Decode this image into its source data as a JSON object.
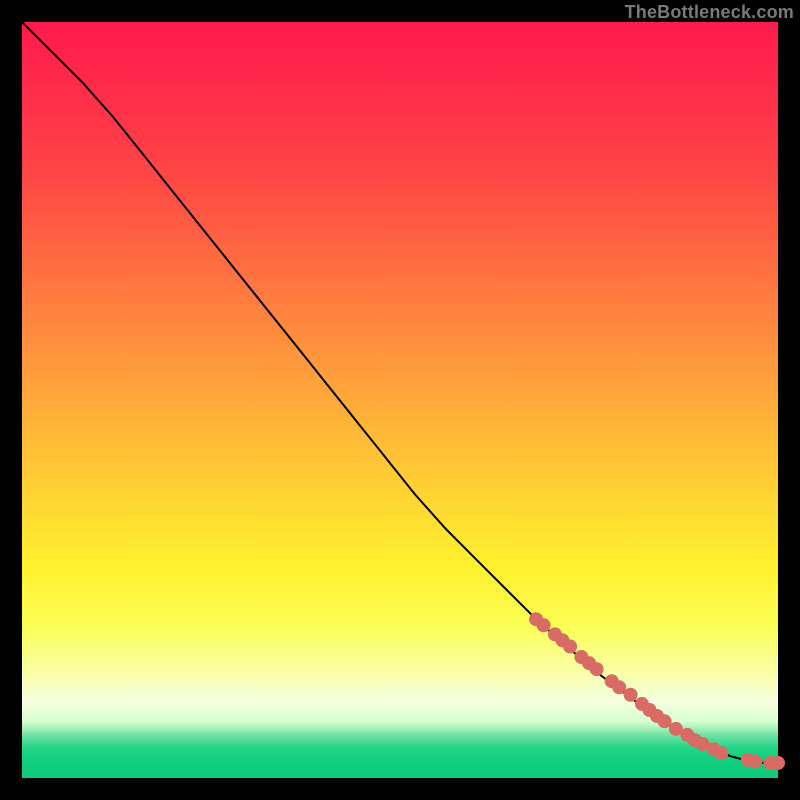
{
  "watermark": "TheBottleneck.com",
  "chart_data": {
    "type": "line",
    "title": "",
    "xlabel": "",
    "ylabel": "",
    "xlim": [
      0,
      100
    ],
    "ylim": [
      0,
      100
    ],
    "grid": false,
    "legend": false,
    "series": [
      {
        "name": "curve",
        "x": [
          0,
          4,
          8,
          12,
          16,
          20,
          24,
          28,
          32,
          36,
          40,
          44,
          48,
          52,
          56,
          60,
          64,
          68,
          72,
          76,
          80,
          84,
          88,
          90,
          92,
          94,
          96,
          98,
          100
        ],
        "y": [
          100,
          96,
          92,
          87.5,
          82.5,
          77.5,
          72.5,
          67.5,
          62.5,
          57.5,
          52.5,
          47.5,
          42.5,
          37.5,
          33,
          29,
          25,
          21,
          17.5,
          14,
          11,
          8,
          5.5,
          4.5,
          3.5,
          2.8,
          2.3,
          2.0,
          2.0
        ]
      }
    ],
    "markers": {
      "name": "highlighted-points",
      "color": "#d86b64",
      "x": [
        68,
        69,
        70.5,
        71.5,
        72.5,
        74,
        75,
        76,
        78,
        79,
        80.5,
        82,
        83,
        84,
        85,
        86.5,
        88,
        89,
        90,
        91.5,
        92.5,
        96,
        97,
        99,
        100
      ],
      "y": [
        21.0,
        20.2,
        19.0,
        18.2,
        17.4,
        16.0,
        15.2,
        14.4,
        12.8,
        12.0,
        11.0,
        9.8,
        9.0,
        8.2,
        7.5,
        6.5,
        5.7,
        5.0,
        4.5,
        3.8,
        3.3,
        2.4,
        2.2,
        2.0,
        2.0
      ]
    }
  }
}
